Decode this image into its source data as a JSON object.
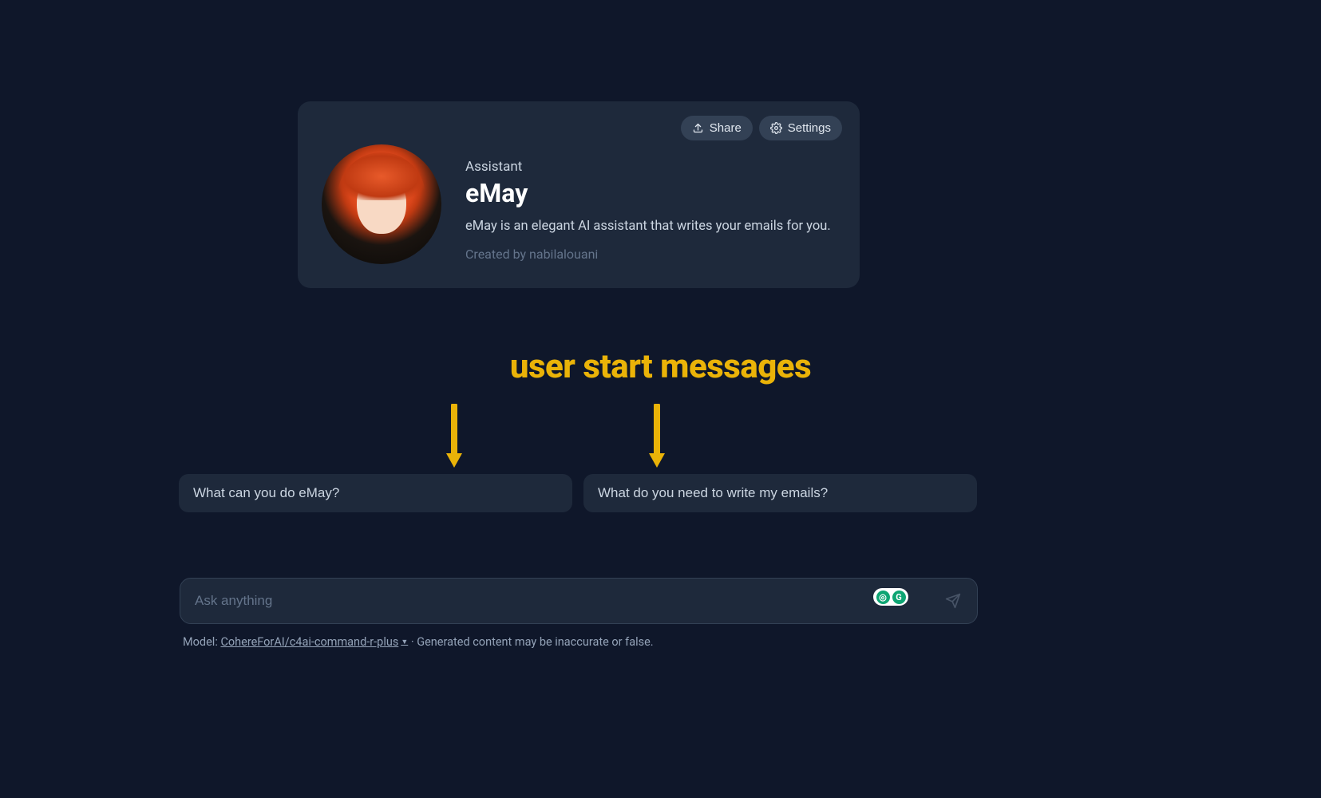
{
  "card": {
    "share_label": "Share",
    "settings_label": "Settings",
    "assistant_label": "Assistant",
    "title": "eMay",
    "description": "eMay is an elegant AI assistant that writes your emails for you.",
    "creator": "Created by nabilalouani"
  },
  "annotation": {
    "text": "user start messages"
  },
  "suggestions": [
    "What can you do eMay?",
    "What do you need to write my emails?"
  ],
  "input": {
    "placeholder": "Ask anything"
  },
  "footer": {
    "model_prefix": "Model: ",
    "model": "CohereForAI/c4ai-command-r-plus",
    "disclaimer": " · Generated content may be inaccurate or false."
  }
}
